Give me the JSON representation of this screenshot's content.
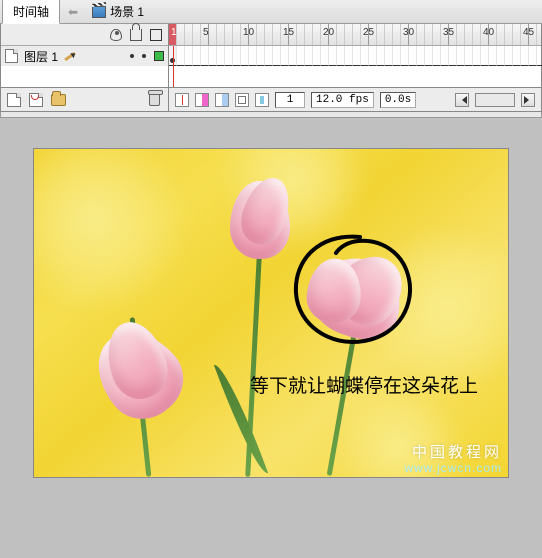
{
  "tabs": {
    "timeline": "时间轴",
    "scene": "场景 1",
    "back": "⬅"
  },
  "layer": {
    "name": "图层 1"
  },
  "ruler": {
    "start": 1,
    "major": [
      5,
      10,
      15,
      20,
      25,
      30,
      35,
      40,
      45
    ]
  },
  "status": {
    "current_frame": "1",
    "fps": "12.0 fps",
    "elapsed": "0.0s"
  },
  "canvas": {
    "annotation": "等下就让蝴蝶停在这朵花上",
    "watermark_cn": "中国教程网",
    "watermark_url": "www.jcwcn.com"
  },
  "icons": {
    "eye": "eye",
    "lock": "lock",
    "outline": "outline",
    "new_layer": "new-layer",
    "new_folder": "new-folder",
    "trash": "trash"
  }
}
